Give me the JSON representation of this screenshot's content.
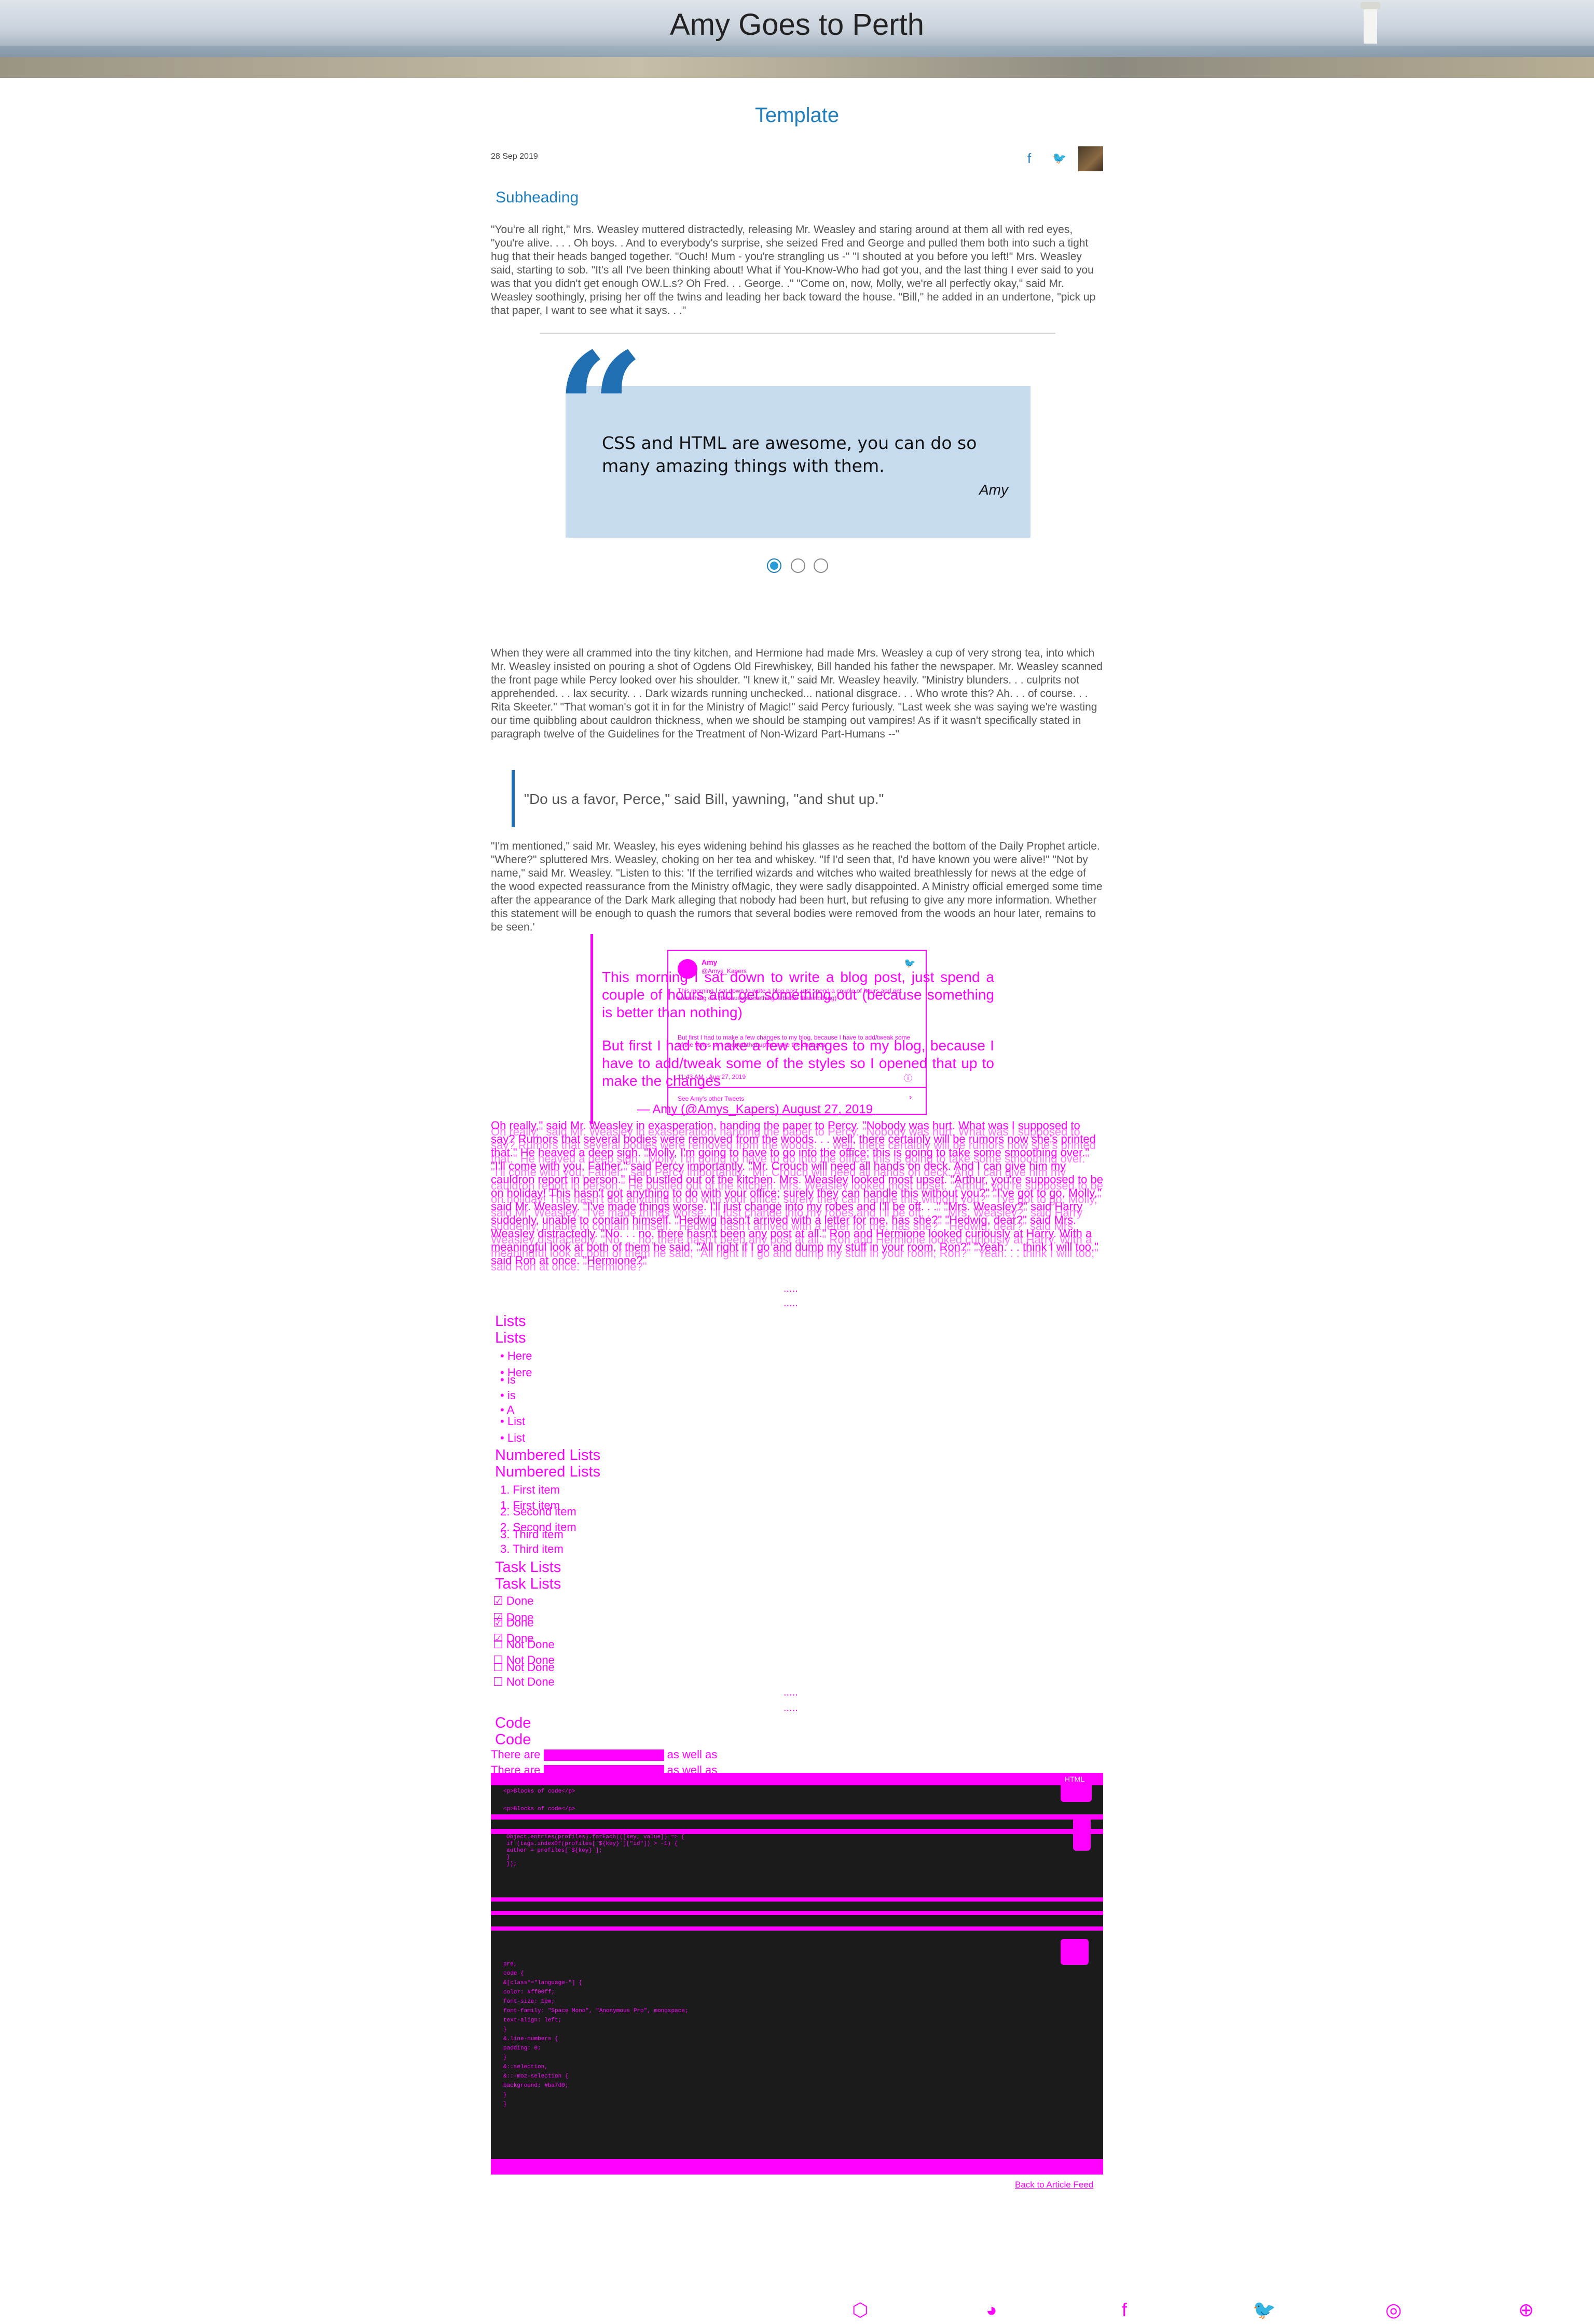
{
  "site": {
    "title": "Amy Goes to Perth"
  },
  "post": {
    "title": "Template",
    "date": "28 Sep 2019",
    "share_facebook": "f",
    "share_twitter": "🐦",
    "subheading": "Subheading"
  },
  "paragraphs": {
    "p1": "\"You're all right,\" Mrs. Weasley muttered distractedly, releasing Mr. Weasley and staring around at them all with red eyes, \"you're alive. . . . Oh boys. . And to everybody's surprise, she seized Fred and George and pulled them both into such a tight hug that their heads banged together. \"Ouch! Mum - you're strangling us -\" \"I shouted at you before you left!\" Mrs. Weasley said, starting to sob. \"It's all I've been thinking about! What if You-Know-Who had got you, and the last thing I ever said to you was that you didn't get enough OW.L.s? Oh Fred. . . George. .\" \"Come on, now, Molly, we're all perfectly okay,\" said Mr. Weasley soothingly, prising her off the twins and leading her back toward the house. \"Bill,\" he added in an undertone, \"pick up that paper, I want to see what it says. . .\"",
    "p2": "When they were all crammed into the tiny kitchen, and Hermione had made Mrs. Weasley a cup of very strong tea, into which Mr. Weasley insisted on pouring a shot of Ogdens Old Firewhiskey, Bill handed his father the newspaper. Mr. Weasley scanned the front page while Percy looked over his shoulder. \"I knew it,\" said Mr. Weasley heavily. \"Ministry blunders. . . culprits not apprehended. . . lax security. . . Dark wizards running unchecked... national disgrace. . . Who wrote this? Ah. . . of course. . . Rita Skeeter.\" \"That woman's got it in for the Ministry of Magic!\" said Percy furiously. \"Last week she was saying we're wasting our time quibbling about cauldron thickness, when we should be stamping out vampires! As if it wasn't specifically stated in paragraph twelve of the Guidelines for the Treatment of Non-Wizard Part-Humans --\"",
    "p3": "\"I'm mentioned,\" said Mr. Weasley, his eyes widening behind his glasses as he reached the bottom of the Daily Prophet article. \"Where?\" spluttered Mrs. Weasley, choking on her tea and whiskey. \"If I'd seen that, I'd have known you were alive!\" \"Not by name,\" said Mr. Weasley. \"Listen to this: 'If the terrified wizards and witches who waited breathlessly for news at the edge of the wood expected reassurance from the Ministry ofMagic, they were sadly disappointed. A Ministry official emerged some time after the appearance of the Dark Mark alleging that nobody had been hurt, but refusing to give any more information. Whether this statement will be enough to quash the rumors that several bodies were removed from the woods an hour later, remains to be seen.'",
    "p4": "Oh really,\" said Mr. Weasley in exasperation, handing the paper to Percy. \"Nobody was hurt. What was I supposed to say? Rumors that several bodies were removed from the woods. . . well, there certainly will be rumors now she's printed that.\" He heaved a deep sigh. \"Molly, I'm going to have to go into the office; this is going to take some smoothing over.\" \"I'll come with you, Father,\" said Percy importantly. \"Mr. Crouch will need all hands on deck. And I can give him my cauldron report in person.\" He bustled out of the kitchen. Mrs. Weasley looked most upset. \"Arthur, you're supposed to be on holiday! This hasn't got anything to do with your office; surely they can handle this without you?\" \"I've got to go, Molly,\" said Mr. Weasley. \"I've made things worse. I'll just change into my robes and I'll be off. . .\" \"Mrs. Weasley?\" said Harry suddenly, unable to contain himself. \"Hedwig hasn't arrived with a letter for me, has she?\" \"Hedwig, dear?\" said Mrs. Weasley distractedly. \"No. . . no, there hasn't been any post at all.\" Ron and Hermione looked curiously at Harry. With a meaningful look at both of them he said, \"All right if I go and dump my stuff in your room, Ron?\" \"Yeah. . . think I will too,\" said Ron at once. \"Hermione?\""
  },
  "quote": {
    "text": "CSS and HTML are awesome, you can do so many amazing things with them.",
    "author": "Amy"
  },
  "blockquote2": "\"Do us a favor, Perce,\" said Bill, yawning, \"and shut up.\"",
  "tweet": {
    "p1": "This morning I sat down to write a blog post, just spend a couple of hours and get something out (because something is better than nothing)",
    "p2": "But first I had to make a few changes to my blog, because I have to add/tweak some of the styles so I opened that up to make the changes",
    "footer_author": "— Amy",
    "footer_handle": "(@Amys_Kapers)",
    "footer_date": "August 27, 2019",
    "card_name": "Amy",
    "card_handle": "@Amys_Kapers",
    "card_text1": "This morning I sat down to write a blog post, just spend a couple of hours and get something out (because something is better than nothing)",
    "card_text2": "But first I had to make a few changes to my blog, because I have to add/tweak some of the styles so I opened that up to make the changes",
    "card_time": "11:43 AM · Aug 27, 2019",
    "card_more": "See Amy's other Tweets"
  },
  "divider": ".....",
  "lists": {
    "heading": "Lists",
    "items": [
      "Here",
      "is",
      "A",
      "List"
    ],
    "numbered_heading": "Numbered Lists",
    "numbered": [
      "First item",
      "Second item",
      "Third item"
    ],
    "task_heading": "Task Lists",
    "tasks": [
      "Done",
      "Done",
      "Not Done",
      "Not Done"
    ]
  },
  "code": {
    "heading": "Code",
    "intro_start": "There are",
    "intro_end": "as well as",
    "lang": "HTML",
    "lines_a": [
      "<p>Blocks of code</p>",
      "<p>Blocks of code</p>"
    ],
    "lines_b": [
      "Object.entries(profiles).forEach(([key, value]) => {",
      "  if (tags.indexOf(profiles[`${key}`][\"id\"]) > -1) {",
      "    author = profiles[`${key}`];",
      "  }",
      "});"
    ],
    "lines_c": [
      "pre,",
      "code {",
      "  &[class*=\"language-\"] {",
      "    color: #ff00ff;",
      "    font-size: 1em;",
      "    font-family: \"Space Mono\", \"Anonymous Pro\", monospace;",
      "    text-align: left;",
      "  }",
      "  &.line-numbers {",
      "    padding: 0;",
      "  }",
      "  &::selection,",
      "  &::-moz-selection {",
      "    background: #ba7d0;",
      "  }",
      "}"
    ]
  },
  "back_link": "Back to Article Feed",
  "footer_icons": [
    "codepen-icon",
    "github-icon",
    "facebook-icon",
    "twitter-icon",
    "instagram-icon",
    "globe-icon"
  ],
  "colors": {
    "accent": "#1f7fbf",
    "quote_bg": "#c6dcee",
    "overlay": "#ff00ff",
    "code_bg": "#1b1b1b"
  }
}
